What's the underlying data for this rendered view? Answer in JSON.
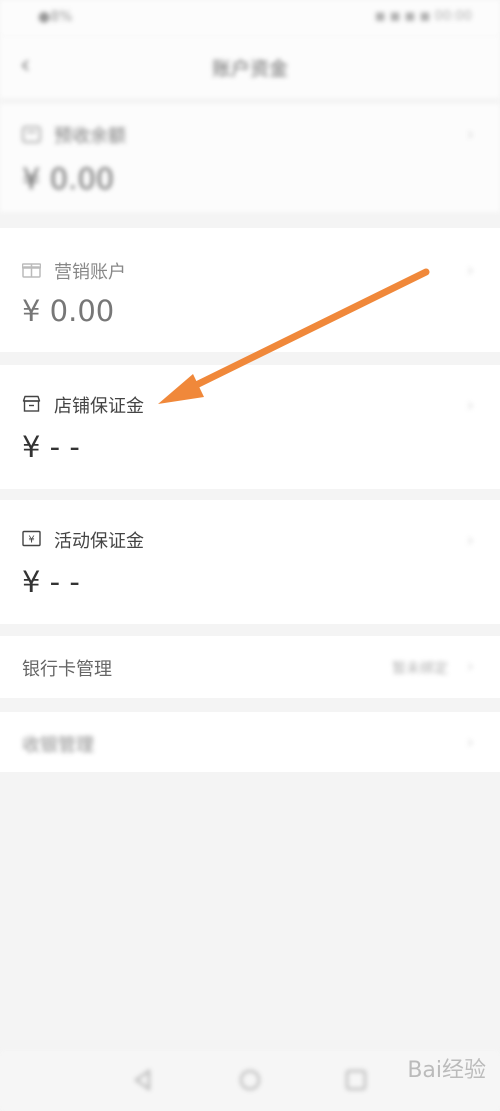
{
  "status": {
    "left": "●8%",
    "right": "◼ ◼ ◼ ◼ 00:00"
  },
  "header": {
    "back_icon": "‹",
    "title": "账户资金"
  },
  "balance_card": {
    "label": "预收余额",
    "amount": "¥ 0.00"
  },
  "marketing_card": {
    "label": "营销账户",
    "amount": "¥ 0.00"
  },
  "store_deposit_card": {
    "label": "店铺保证金",
    "amount": "¥ - -"
  },
  "activity_deposit_card": {
    "label": "活动保证金",
    "amount": "¥ - -"
  },
  "bank_row": {
    "label": "银行卡管理",
    "value": "暂未绑定"
  },
  "other_row": {
    "label": "收银管理"
  },
  "chevron": "›",
  "watermark": "Bai经验",
  "annotation": {
    "color": "#f0883a"
  }
}
